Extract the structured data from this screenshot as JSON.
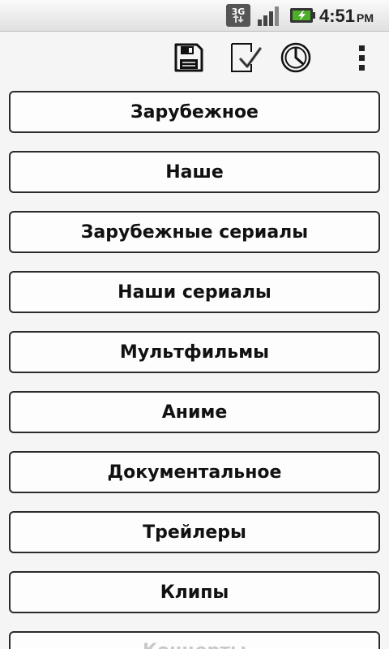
{
  "status_bar": {
    "network_label": "3G",
    "time": "4:51",
    "ampm": "PM",
    "icons": [
      "3g-data-icon",
      "signal-strength-icon",
      "battery-charging-icon"
    ]
  },
  "action_bar": {
    "icons": [
      "save-icon",
      "checklist-icon",
      "history-clock-icon",
      "overflow-menu-icon"
    ]
  },
  "categories": [
    "Зарубежное",
    "Наше",
    "Зарубежные сериалы",
    "Наши сериалы",
    "Мультфильмы",
    "Аниме",
    "Документальное",
    "Трейлеры",
    "Клипы",
    "Концерты"
  ],
  "colors": {
    "background": "#f5f5f5",
    "button_border": "#2b2b2b",
    "battery_green": "#4caf28"
  }
}
